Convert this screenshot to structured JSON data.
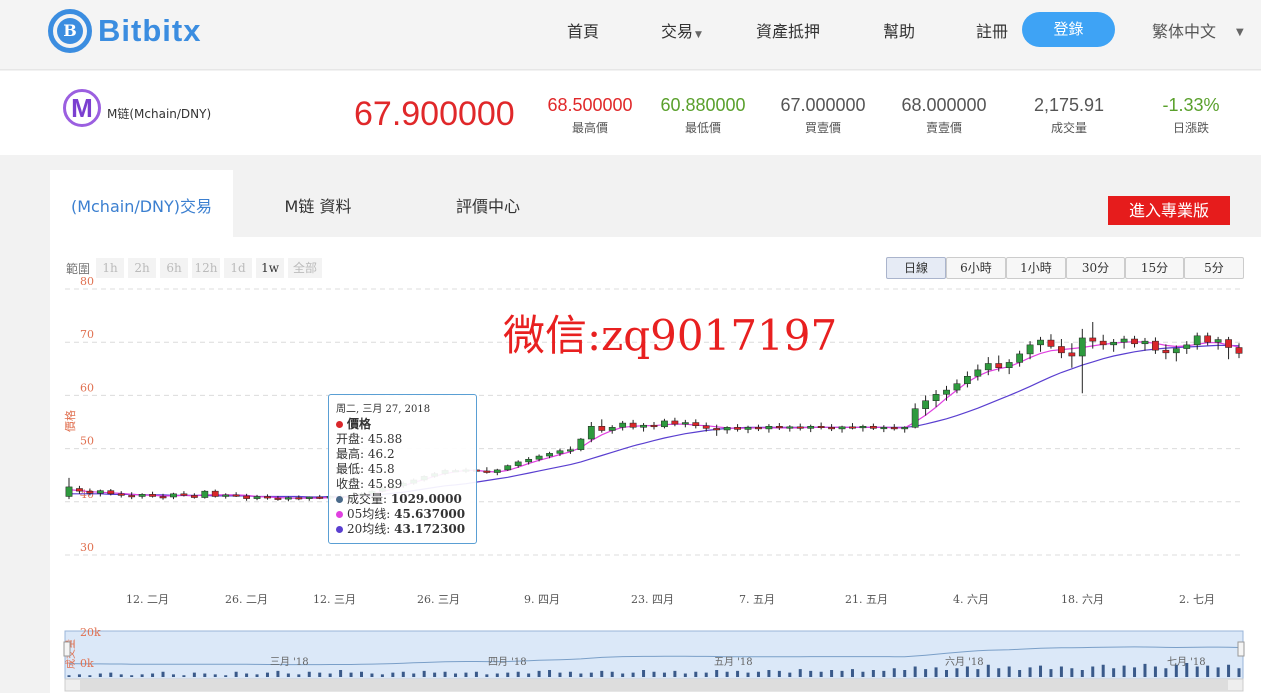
{
  "brand": {
    "logo_glyph": "B",
    "name": "Bitbitx",
    "color": "#3b8de0"
  },
  "nav": {
    "home": "首頁",
    "trade": "交易",
    "asset": "資產抵押",
    "help": "幫助",
    "register": "註冊",
    "login": "登錄",
    "language": "繁体中文"
  },
  "ticker": {
    "coin_glyph": "M",
    "pair": "M链(Mchain/DNY)",
    "last_price": "67.900000",
    "stats": [
      {
        "value": "68.500000",
        "label": "最高價",
        "color": "#e0282a"
      },
      {
        "value": "60.880000",
        "label": "最低價",
        "color": "#5aa02c"
      },
      {
        "value": "67.000000",
        "label": "買壹價",
        "color": "#555555"
      },
      {
        "value": "68.000000",
        "label": "賣壹價",
        "color": "#555555"
      },
      {
        "value": "2,175.91",
        "label": "成交量",
        "color": "#555555"
      },
      {
        "value": "-1.33%",
        "label": "日漲跌",
        "color": "#5aa02c"
      }
    ]
  },
  "tabs": [
    "(Mchain/DNY)交易",
    "M链 資料",
    "評價中心"
  ],
  "pro_button": "進入專業版",
  "range": {
    "label": "範圍",
    "options": [
      "1h",
      "2h",
      "6h",
      "12h",
      "1d",
      "1w",
      "全部"
    ],
    "selected": "1w"
  },
  "periods": {
    "options": [
      "日線",
      "6小時",
      "1小時",
      "30分",
      "15分",
      "5分"
    ],
    "selected": "日線"
  },
  "watermark": "微信:zq9017197",
  "tooltip": {
    "date": "周二, 三月 27, 2018",
    "series": "價格",
    "open_label": "开盘:",
    "open": "45.88",
    "high_label": "最高:",
    "high": "46.2",
    "low_label": "最低:",
    "low": "45.8",
    "close_label": "收盘:",
    "close": "45.89",
    "volume_label": "成交量:",
    "volume": "1029.0000",
    "ma5_label": "05均线:",
    "ma5": "45.637000",
    "ma20_label": "20均线:",
    "ma20": "43.172300"
  },
  "chart_data": {
    "type": "candlestick",
    "ylabel": "價格",
    "ylim": [
      30,
      80
    ],
    "yticks": [
      30,
      40,
      50,
      60,
      70,
      80
    ],
    "xticks": [
      "12. 二月",
      "26. 二月",
      "12. 三月",
      "26. 三月",
      "9. 四月",
      "23. 四月",
      "7. 五月",
      "21. 五月",
      "4. 六月",
      "18. 六月",
      "2. 七月"
    ],
    "colors": {
      "up": "#2e9a3e",
      "down": "#d9262a",
      "ma5": "#e040e0",
      "ma20": "#5a3fd0"
    },
    "ohlc": [
      [
        41.0,
        44.5,
        40.5,
        42.8
      ],
      [
        42.5,
        43.0,
        41.5,
        42.0
      ],
      [
        42.0,
        42.5,
        41.2,
        41.6
      ],
      [
        41.6,
        42.3,
        41.0,
        42.1
      ],
      [
        42.1,
        42.4,
        41.2,
        41.5
      ],
      [
        41.5,
        42.0,
        40.8,
        41.2
      ],
      [
        41.2,
        41.8,
        40.5,
        41.0
      ],
      [
        41.0,
        41.6,
        40.6,
        41.4
      ],
      [
        41.4,
        41.9,
        40.8,
        41.0
      ],
      [
        41.0,
        41.5,
        40.4,
        40.9
      ],
      [
        40.9,
        41.7,
        40.5,
        41.5
      ],
      [
        41.5,
        42.0,
        41.0,
        41.2
      ],
      [
        41.2,
        41.6,
        40.6,
        40.8
      ],
      [
        40.8,
        42.2,
        40.6,
        42.0
      ],
      [
        42.0,
        42.3,
        40.8,
        41.0
      ],
      [
        41.0,
        41.6,
        40.6,
        41.3
      ],
      [
        41.3,
        41.8,
        40.9,
        41.1
      ],
      [
        41.1,
        41.5,
        40.2,
        40.6
      ],
      [
        40.6,
        41.3,
        40.3,
        41.0
      ],
      [
        41.0,
        41.4,
        40.4,
        40.7
      ],
      [
        40.7,
        41.1,
        40.2,
        40.5
      ],
      [
        40.5,
        41.0,
        40.1,
        40.8
      ],
      [
        40.8,
        41.2,
        40.3,
        40.6
      ],
      [
        40.6,
        41.0,
        40.2,
        40.9
      ],
      [
        40.9,
        41.3,
        40.5,
        40.7
      ],
      [
        40.7,
        41.2,
        40.4,
        41.0
      ],
      [
        41.0,
        41.5,
        40.6,
        40.8
      ],
      [
        40.8,
        41.3,
        40.5,
        41.1
      ],
      [
        41.1,
        41.8,
        40.8,
        41.5
      ],
      [
        41.5,
        42.2,
        41.2,
        42.0
      ],
      [
        42.0,
        42.8,
        41.8,
        42.5
      ],
      [
        42.5,
        43.2,
        42.2,
        43.0
      ],
      [
        43.0,
        43.8,
        42.6,
        43.5
      ],
      [
        43.5,
        44.4,
        43.2,
        44.1
      ],
      [
        44.1,
        45.0,
        43.8,
        44.8
      ],
      [
        44.8,
        45.6,
        44.5,
        45.3
      ],
      [
        45.3,
        46.2,
        45.0,
        45.9
      ],
      [
        45.88,
        46.2,
        45.8,
        45.89
      ],
      [
        45.9,
        46.4,
        45.4,
        46.0
      ],
      [
        46.0,
        46.8,
        45.6,
        45.8
      ],
      [
        45.8,
        46.5,
        45.3,
        45.5
      ],
      [
        45.5,
        46.2,
        45.0,
        46.0
      ],
      [
        46.0,
        47.0,
        45.8,
        46.8
      ],
      [
        46.8,
        47.8,
        46.4,
        47.5
      ],
      [
        47.5,
        48.4,
        47.0,
        48.0
      ],
      [
        48.0,
        48.9,
        47.6,
        48.6
      ],
      [
        48.6,
        49.4,
        48.2,
        49.1
      ],
      [
        49.1,
        50.0,
        48.6,
        49.6
      ],
      [
        49.6,
        50.4,
        49.0,
        49.8
      ],
      [
        49.8,
        52.0,
        49.5,
        51.8
      ],
      [
        51.8,
        55.0,
        51.2,
        54.2
      ],
      [
        54.2,
        55.5,
        53.0,
        53.4
      ],
      [
        53.4,
        54.4,
        52.8,
        54.0
      ],
      [
        54.0,
        55.2,
        53.4,
        54.8
      ],
      [
        54.8,
        55.4,
        53.6,
        54.0
      ],
      [
        54.0,
        54.8,
        53.2,
        54.4
      ],
      [
        54.4,
        55.0,
        53.6,
        54.1
      ],
      [
        54.1,
        55.6,
        53.8,
        55.2
      ],
      [
        55.2,
        55.8,
        54.2,
        54.6
      ],
      [
        54.6,
        55.4,
        54.0,
        54.9
      ],
      [
        54.9,
        55.5,
        53.8,
        54.3
      ],
      [
        54.3,
        54.9,
        53.2,
        53.8
      ],
      [
        53.8,
        54.5,
        52.4,
        53.5
      ],
      [
        53.5,
        54.2,
        52.8,
        54.0
      ],
      [
        54.0,
        54.6,
        53.2,
        53.6
      ],
      [
        53.6,
        54.3,
        52.9,
        54.0
      ],
      [
        54.0,
        54.5,
        53.3,
        53.7
      ],
      [
        53.7,
        54.6,
        53.0,
        54.2
      ],
      [
        54.2,
        54.8,
        53.5,
        53.9
      ],
      [
        53.9,
        54.4,
        53.2,
        54.1
      ],
      [
        54.1,
        54.7,
        53.4,
        53.8
      ],
      [
        53.8,
        54.5,
        53.1,
        54.2
      ],
      [
        54.2,
        54.9,
        53.6,
        54.0
      ],
      [
        54.0,
        54.6,
        53.3,
        53.7
      ],
      [
        53.7,
        54.3,
        53.0,
        54.1
      ],
      [
        54.1,
        54.8,
        53.6,
        53.9
      ],
      [
        53.9,
        54.5,
        53.2,
        54.2
      ],
      [
        54.2,
        54.7,
        53.5,
        53.8
      ],
      [
        53.8,
        54.4,
        53.1,
        54.0
      ],
      [
        54.0,
        54.6,
        53.4,
        53.7
      ],
      [
        53.7,
        54.2,
        53.0,
        54.0
      ],
      [
        54.0,
        58.5,
        53.8,
        57.5
      ],
      [
        57.5,
        60.0,
        56.2,
        59.0
      ],
      [
        59.0,
        61.0,
        57.8,
        60.2
      ],
      [
        60.2,
        61.8,
        59.0,
        61.0
      ],
      [
        61.0,
        63.0,
        60.4,
        62.2
      ],
      [
        62.2,
        64.5,
        61.5,
        63.6
      ],
      [
        63.6,
        65.8,
        62.8,
        64.8
      ],
      [
        64.8,
        67.2,
        63.8,
        66.0
      ],
      [
        66.0,
        67.5,
        64.5,
        65.2
      ],
      [
        65.2,
        66.8,
        64.0,
        66.2
      ],
      [
        66.2,
        68.4,
        65.4,
        67.8
      ],
      [
        67.8,
        70.2,
        66.8,
        69.5
      ],
      [
        69.5,
        71.0,
        68.2,
        70.4
      ],
      [
        70.4,
        71.5,
        68.8,
        69.2
      ],
      [
        69.2,
        70.6,
        67.0,
        68.0
      ],
      [
        68.0,
        69.8,
        65.2,
        67.4
      ],
      [
        67.4,
        72.5,
        60.4,
        70.8
      ],
      [
        70.8,
        73.8,
        68.8,
        70.2
      ],
      [
        70.2,
        71.4,
        68.6,
        69.5
      ],
      [
        69.5,
        70.6,
        68.2,
        70.0
      ],
      [
        70.0,
        71.2,
        68.8,
        70.6
      ],
      [
        70.6,
        71.2,
        69.0,
        69.7
      ],
      [
        69.7,
        70.8,
        68.4,
        70.2
      ],
      [
        70.2,
        70.9,
        67.8,
        68.5
      ],
      [
        68.5,
        69.6,
        66.8,
        68.0
      ],
      [
        68.0,
        69.4,
        66.4,
        68.8
      ],
      [
        68.8,
        70.2,
        67.8,
        69.5
      ],
      [
        69.5,
        71.8,
        68.6,
        71.2
      ],
      [
        71.2,
        71.8,
        69.4,
        70.0
      ],
      [
        70.0,
        71.0,
        68.6,
        70.5
      ],
      [
        70.5,
        71.0,
        66.8,
        69.0
      ],
      [
        69.0,
        69.8,
        67.0,
        67.9
      ]
    ],
    "ma5": [
      42.3,
      42.1,
      41.9,
      41.8,
      41.7,
      41.6,
      41.4,
      41.3,
      41.2,
      41.1,
      41.1,
      41.2,
      41.1,
      41.3,
      41.3,
      41.3,
      41.3,
      41.2,
      41.0,
      40.9,
      40.8,
      40.7,
      40.7,
      40.7,
      40.7,
      40.8,
      40.8,
      40.9,
      41.1,
      41.5,
      41.9,
      42.4,
      43.0,
      43.6,
      44.2,
      44.8,
      45.3,
      45.64,
      45.9,
      45.9,
      45.7,
      45.6,
      45.9,
      46.5,
      47.2,
      47.8,
      48.3,
      48.9,
      49.4,
      50.2,
      51.5,
      52.6,
      53.4,
      54.0,
      54.2,
      54.3,
      54.3,
      54.5,
      54.6,
      54.6,
      54.4,
      54.3,
      54.1,
      53.9,
      53.8,
      53.9,
      53.9,
      53.9,
      53.9,
      53.9,
      53.9,
      54.0,
      54.0,
      54.0,
      54.0,
      54.0,
      54.0,
      54.0,
      54.0,
      53.9,
      53.9,
      55.0,
      56.3,
      57.8,
      59.5,
      61.0,
      62.5,
      63.6,
      64.5,
      65.0,
      65.4,
      66.2,
      67.1,
      67.9,
      68.4,
      68.6,
      68.8,
      69.0,
      69.3,
      69.6,
      69.8,
      70.0,
      70.1,
      70.0,
      69.8,
      69.4,
      69.2,
      69.3,
      69.6,
      69.9,
      69.9,
      69.5,
      69.1
    ],
    "ma20": [
      41.5,
      41.5,
      41.5,
      41.5,
      41.4,
      41.4,
      41.4,
      41.3,
      41.3,
      41.3,
      41.2,
      41.2,
      41.2,
      41.2,
      41.1,
      41.1,
      41.1,
      41.1,
      41.0,
      41.0,
      41.0,
      41.0,
      41.0,
      40.9,
      40.9,
      41.0,
      41.0,
      41.0,
      41.1,
      41.2,
      41.4,
      41.6,
      41.8,
      42.1,
      42.4,
      42.7,
      43.0,
      43.17,
      43.4,
      43.7,
      44.0,
      44.3,
      44.6,
      45.0,
      45.4,
      45.8,
      46.2,
      46.6,
      47.0,
      47.5,
      48.1,
      48.7,
      49.3,
      49.9,
      50.5,
      51.0,
      51.5,
      52.0,
      52.4,
      52.8,
      53.1,
      53.4,
      53.6,
      53.8,
      53.9,
      54.0,
      54.0,
      54.0,
      54.0,
      54.0,
      54.0,
      54.0,
      54.0,
      54.0,
      54.0,
      54.0,
      54.0,
      54.0,
      54.0,
      54.0,
      54.0,
      54.2,
      54.6,
      55.1,
      55.6,
      56.2,
      56.9,
      57.6,
      58.4,
      59.2,
      60.0,
      60.8,
      61.7,
      62.6,
      63.5,
      64.3,
      65.0,
      65.7,
      66.3,
      66.9,
      67.4,
      67.8,
      68.2,
      68.5,
      68.7,
      68.9,
      69.0,
      69.1,
      69.2,
      69.3,
      69.4,
      69.4,
      69.3
    ],
    "volume": [
      2,
      3,
      2,
      4,
      5,
      3,
      2,
      3,
      4,
      6,
      3,
      2,
      5,
      4,
      3,
      2,
      6,
      4,
      3,
      5,
      7,
      4,
      3,
      6,
      5,
      4,
      8,
      5,
      6,
      4,
      3,
      5,
      6,
      4,
      7,
      5,
      6,
      4,
      5,
      6,
      3,
      4,
      5,
      6,
      4,
      7,
      8,
      5,
      6,
      4,
      5,
      7,
      6,
      4,
      5,
      8,
      6,
      5,
      7,
      4,
      6,
      5,
      8,
      6,
      7,
      5,
      6,
      8,
      7,
      5,
      9,
      7,
      6,
      8,
      7,
      9,
      6,
      8,
      7,
      10,
      8,
      12,
      9,
      11,
      8,
      10,
      12,
      9,
      14,
      10,
      12,
      8,
      11,
      13,
      9,
      12,
      10,
      8,
      12,
      14,
      10,
      13,
      11,
      15,
      12,
      10,
      14,
      16,
      12,
      13,
      11,
      14,
      10
    ],
    "navigator": {
      "label": "成交量",
      "ylim": [
        0,
        20000
      ],
      "ytick_labels": [
        "0k",
        "20k"
      ],
      "xticks": [
        "三月 '18",
        "四月 '18",
        "五月 '18",
        "六月 '18",
        "七月 '18"
      ]
    }
  }
}
